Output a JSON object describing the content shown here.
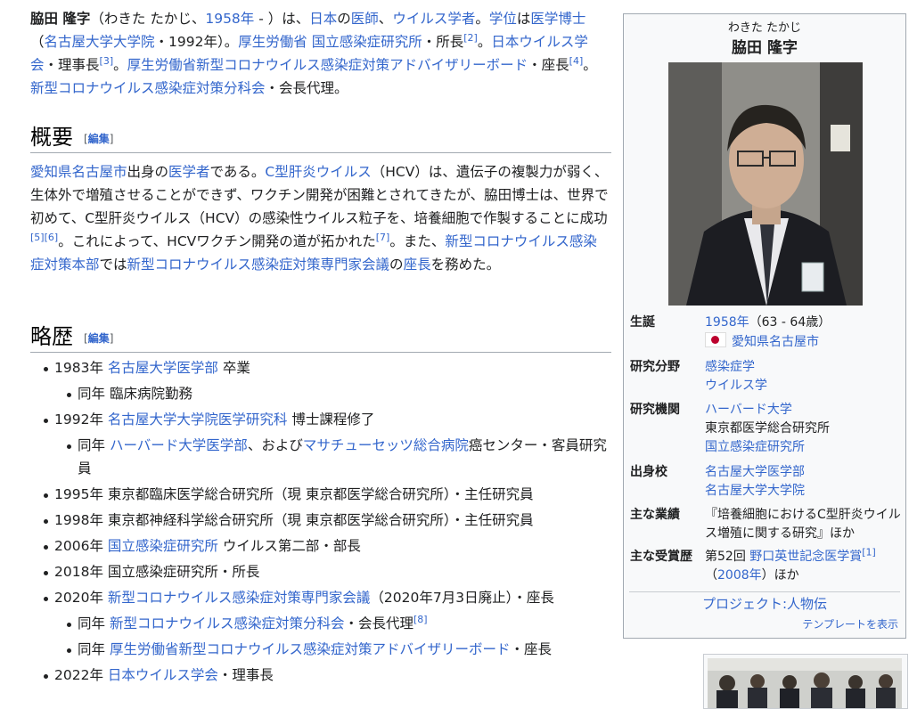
{
  "lead": {
    "name": "脇田 隆字",
    "reading": "（わきた たかじ、",
    "birth_year": "1958年",
    "t1": " - ）は、",
    "l_japan": "日本",
    "t2": "の",
    "l_doctor": "医師",
    "t3": "、",
    "l_virologist": "ウイルス学者",
    "t4": "。",
    "l_degree": "学位",
    "t5": "は",
    "l_md_phd": "医学博士",
    "t6": "（",
    "l_nagoya_grad": "名古屋大学大学院",
    "t7": "・1992年）。",
    "l_mhlw": "厚生労働省",
    "t8": " ",
    "l_niid": "国立感染症研究所",
    "t9": "・所長",
    "ref2": "[2]",
    "t10": "。",
    "l_jsv": "日本ウイルス学会",
    "t11": "・理事長",
    "ref3": "[3]",
    "t12": "。",
    "l_advisory": "厚生労働省新型コロナウイルス感染症対策アドバイザリーボード",
    "t13": "・座長",
    "ref4": "[4]",
    "t14": "。",
    "l_subcommittee": "新型コロナウイルス感染症対策分科会",
    "t15": "・会長代理。"
  },
  "sections": {
    "overview_title": "概要",
    "career_title": "略歴",
    "edit_open": "[",
    "edit_label": "編集",
    "edit_close": "]"
  },
  "overview": {
    "l_nagoya_city": "愛知県名古屋市",
    "t1": "出身の",
    "l_medical_scientist": "医学者",
    "t2": "である。",
    "l_hcv": "C型肝炎ウイルス",
    "t3": "（HCV）は、遺伝子の複製力が弱く、生体外で増殖させることができず、ワクチン開発が困難とされてきたが、脇田博士は、世界で初めて、C型肝炎ウイルス（HCV）の感染性ウイルス粒子を、培養細胞で作製することに成功",
    "ref5": "[5]",
    "ref6": "[6]",
    "t4": "。これによって、HCVワクチン開発の道が拓かれた",
    "ref7": "[7]",
    "t5": "。また、",
    "l_hq": "新型コロナウイルス感染症対策本部",
    "t6": "では",
    "l_expert_meeting": "新型コロナウイルス感染症対策専門家会議",
    "t7": "の",
    "l_chair": "座長",
    "t8": "を務めた。"
  },
  "career": [
    {
      "year": "1983年",
      "link": "名古屋大学医学部",
      "after": " 卒業"
    },
    {
      "year": "同年",
      "text": "臨床病院勤務"
    },
    {
      "year": "1992年",
      "link": "名古屋大学大学院医学研究科",
      "after": " 博士課程修了"
    },
    {
      "year": "同年",
      "link": "ハーバード大学医学部",
      "mid": "、および",
      "link2": "マサチューセッツ総合病院",
      "after": "癌センター・客員研究員"
    },
    {
      "year": "1995年",
      "text": "東京都臨床医学総合研究所（現 東京都医学総合研究所）・主任研究員"
    },
    {
      "year": "1998年",
      "text": "東京都神経科学総合研究所（現 東京都医学総合研究所）・主任研究員"
    },
    {
      "year": "2006年",
      "link": "国立感染症研究所",
      "after": " ウイルス第二部・部長"
    },
    {
      "year": "2018年",
      "text": "国立感染症研究所・所長"
    },
    {
      "year": "2020年",
      "link": "新型コロナウイルス感染症対策専門家会議",
      "after": "（2020年7月3日廃止）・座長"
    },
    {
      "year": "同年",
      "link": "新型コロナウイルス感染症対策分科会",
      "after": "・会長代理",
      "ref": "[8]"
    },
    {
      "year": "同年",
      "link": "厚生労働省新型コロナウイルス感染症対策アドバイザリーボード",
      "after": "・座長"
    },
    {
      "year": "2022年",
      "link": "日本ウイルス学会",
      "after": "・理事長"
    }
  ],
  "infobox": {
    "kana": "わきた たかじ",
    "name": "脇田 隆字",
    "birth_label": "生誕",
    "birth_year": "1958年",
    "birth_age": "（63 - 64歳）",
    "birth_place": "愛知県名古屋市",
    "field_label": "研究分野",
    "field1": "感染症学",
    "field2": "ウイルス学",
    "inst_label": "研究機関",
    "inst1": "ハーバード大学",
    "inst2": "東京都医学総合研究所",
    "inst3": "国立感染症研究所",
    "alma_label": "出身校",
    "alma1": "名古屋大学医学部",
    "alma2": "名古屋大学大学院",
    "works_label": "主な業績",
    "works": "『培養細胞におけるC型肝炎ウイルス増殖に関する研究』ほか",
    "awards_label": "主な受賞歴",
    "award_prefix": "第52回 ",
    "award_link": "野口英世記念医学賞",
    "award_ref": "[1]",
    "award_open": "（",
    "award_year": "2008年",
    "award_close": "）ほか",
    "project": "プロジェクト:人物伝",
    "template": "テンプレートを表示"
  },
  "colors": {
    "link": "#3366cc",
    "text": "#202122",
    "infobox_bg": "#f8f9fa",
    "border": "#a2a9b1"
  }
}
